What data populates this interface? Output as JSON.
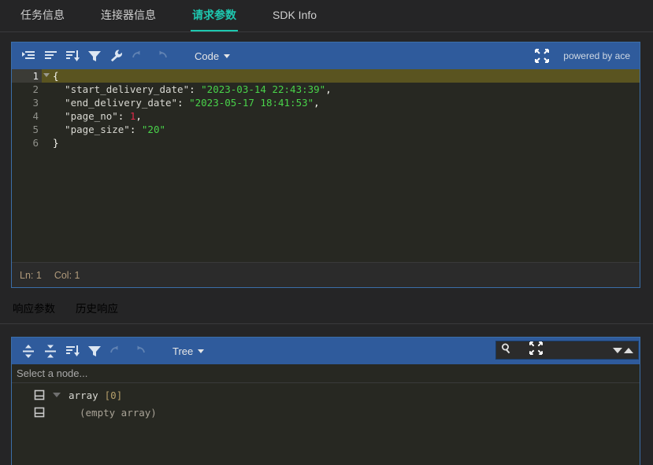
{
  "top_tabs": [
    {
      "label": "任务信息",
      "active": false
    },
    {
      "label": "连接器信息",
      "active": false
    },
    {
      "label": "请求参数",
      "active": true
    },
    {
      "label": "SDK Info",
      "active": false
    }
  ],
  "code_editor": {
    "toolbar": {
      "format_title": "format-icon",
      "compact_title": "compact-icon",
      "sort_title": "sort-icon",
      "filter_title": "filter-icon",
      "settings_title": "wrench-icon",
      "undo_title": "undo-icon",
      "redo_title": "redo-icon",
      "mode_label": "Code",
      "expand_title": "expand-icon",
      "powered_by": "powered by ace"
    },
    "lines": [
      {
        "no": "1",
        "active": true,
        "fold": true,
        "parts": [
          {
            "t": "{",
            "c": "punc"
          }
        ]
      },
      {
        "no": "2",
        "active": false,
        "fold": false,
        "parts": [
          {
            "t": "  \"start_delivery_date\"",
            "c": "key"
          },
          {
            "t": ": ",
            "c": "punc"
          },
          {
            "t": "\"2023-03-14 22:43:39\"",
            "c": "str"
          },
          {
            "t": ",",
            "c": "punc"
          }
        ]
      },
      {
        "no": "3",
        "active": false,
        "fold": false,
        "parts": [
          {
            "t": "  \"end_delivery_date\"",
            "c": "key"
          },
          {
            "t": ": ",
            "c": "punc"
          },
          {
            "t": "\"2023-05-17 18:41:53\"",
            "c": "str"
          },
          {
            "t": ",",
            "c": "punc"
          }
        ]
      },
      {
        "no": "4",
        "active": false,
        "fold": false,
        "parts": [
          {
            "t": "  \"page_no\"",
            "c": "key"
          },
          {
            "t": ": ",
            "c": "punc"
          },
          {
            "t": "1",
            "c": "num"
          },
          {
            "t": ",",
            "c": "punc"
          }
        ]
      },
      {
        "no": "5",
        "active": false,
        "fold": false,
        "parts": [
          {
            "t": "  \"page_size\"",
            "c": "key"
          },
          {
            "t": ": ",
            "c": "punc"
          },
          {
            "t": "\"20\"",
            "c": "str"
          }
        ]
      },
      {
        "no": "6",
        "active": false,
        "fold": false,
        "parts": [
          {
            "t": "}",
            "c": "punc"
          }
        ]
      }
    ],
    "statusbar": {
      "line": "Ln: 1",
      "col": "Col: 1"
    }
  },
  "middle_tabs": [
    {
      "label": "响应参数",
      "active": true
    },
    {
      "label": "历史响应",
      "active": false
    }
  ],
  "tree_editor": {
    "toolbar": {
      "expand_all_title": "expand-all-icon",
      "collapse_all_title": "collapse-all-icon",
      "sort_title": "sort-icon",
      "filter_title": "filter-icon",
      "undo_title": "undo-icon",
      "redo_title": "redo-icon",
      "mode_label": "Tree",
      "search_icon_title": "search-icon",
      "expand_title": "expand-icon",
      "next_title": "next-result-icon",
      "prev_title": "previous-result-icon"
    },
    "hint": "Select a node...",
    "rows": [
      {
        "label": "array",
        "count": "[0]",
        "has_caret": true,
        "empty": false
      },
      {
        "label": "(empty array)",
        "count": "",
        "has_caret": false,
        "empty": true
      }
    ]
  },
  "colors": {
    "accent_tab": "#1ec8b0",
    "toolbar_blue": "#2f5b9c",
    "editor_bg": "#272822",
    "string_green": "#49d24a",
    "number_red": "#e0294a",
    "active_line": "#5a5420"
  }
}
